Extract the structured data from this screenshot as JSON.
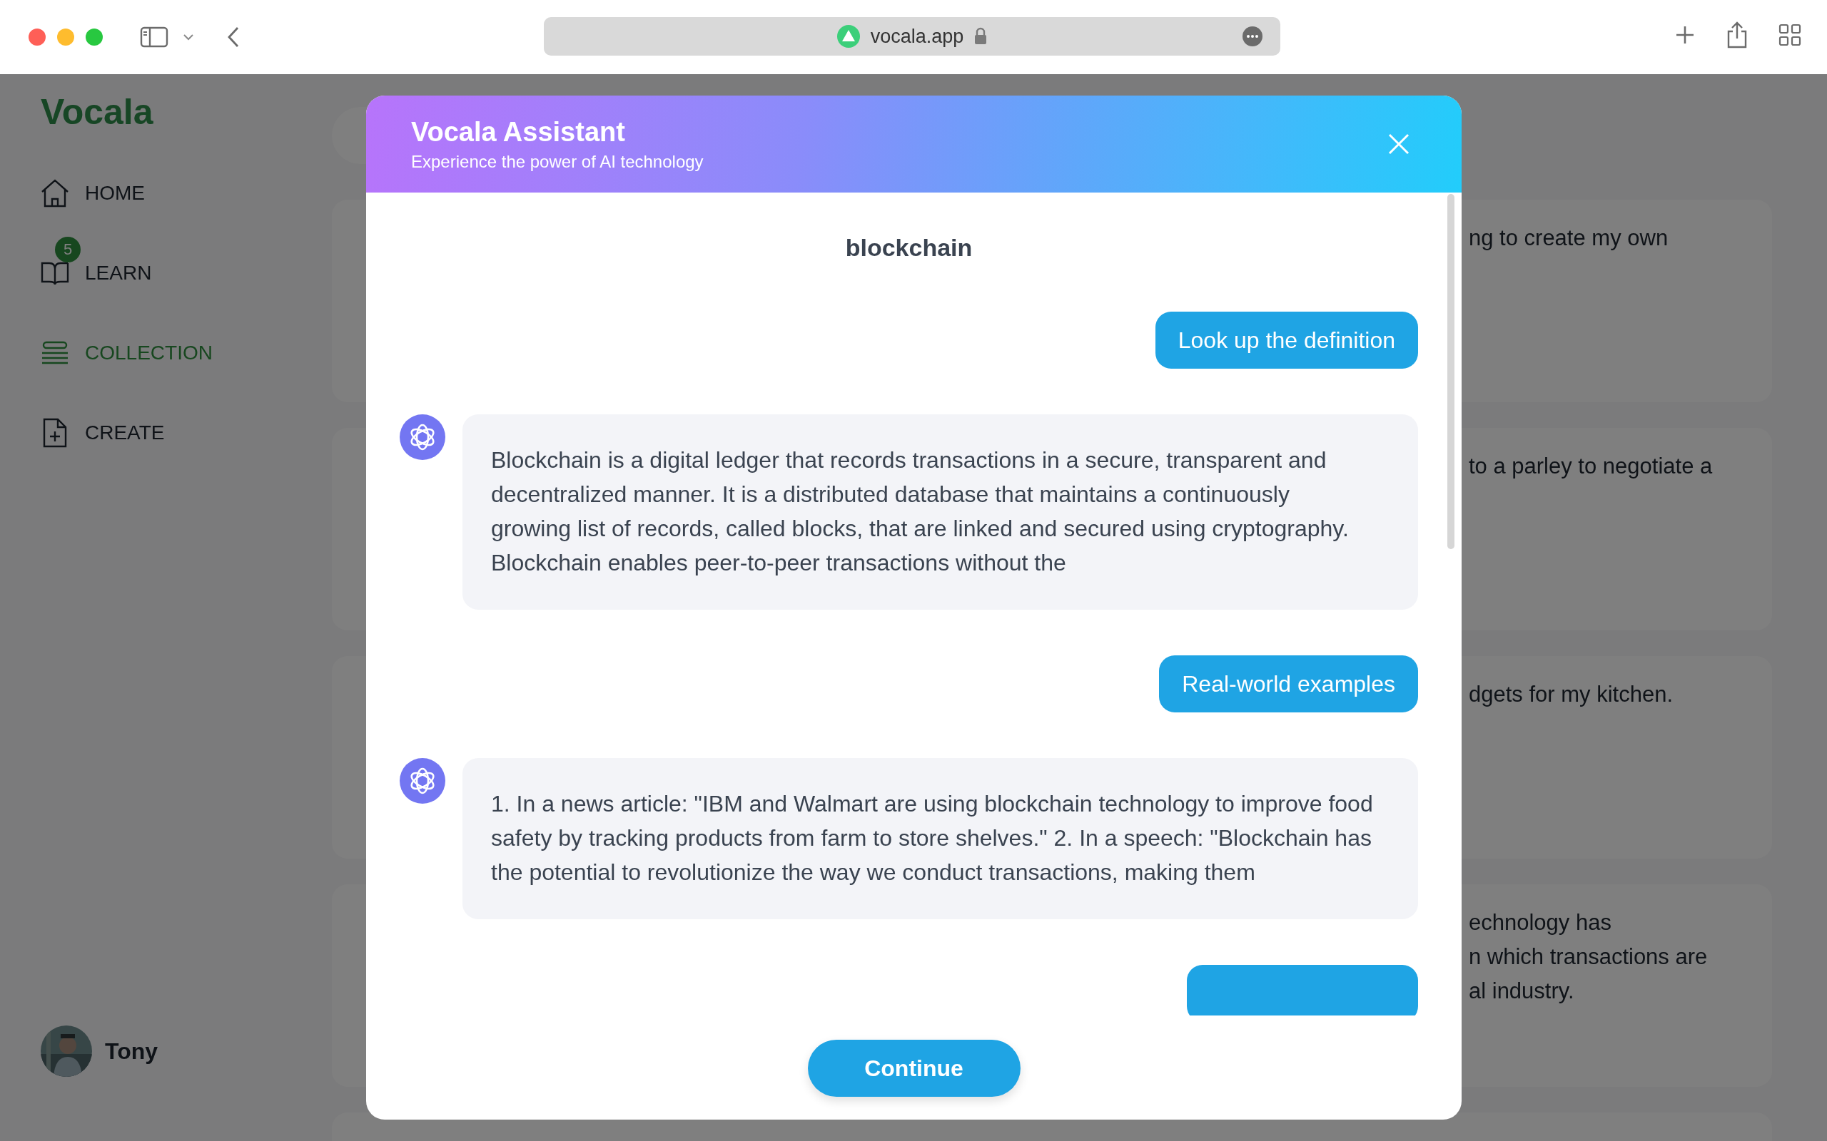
{
  "browser": {
    "url": "vocala.app"
  },
  "sidebar": {
    "logo": "Vocala",
    "items": [
      {
        "label": "HOME",
        "selected": false
      },
      {
        "label": "LEARN",
        "selected": false,
        "badge": "5"
      },
      {
        "label": "COLLECTION",
        "selected": true
      },
      {
        "label": "CREATE",
        "selected": false
      }
    ],
    "user": {
      "name": "Tony"
    }
  },
  "cards": [
    {
      "text": "ng to create my own"
    },
    {
      "text": "to a parley to negotiate a"
    },
    {
      "text": "dgets for my kitchen."
    },
    {
      "text": "echnology has\nn which transactions are\nal industry."
    }
  ],
  "modal": {
    "title": "Vocala Assistant",
    "subtitle": "Experience the power of AI technology",
    "word": "blockchain",
    "messages": [
      {
        "kind": "user",
        "text": "Look up the definition"
      },
      {
        "kind": "assistant",
        "text": "Blockchain is a digital ledger that records transactions in a secure, transparent and decentralized manner. It is a distributed database that maintains a continuously growing list of records, called blocks, that are linked and secured using cryptography. Blockchain enables peer-to-peer transactions without the"
      },
      {
        "kind": "user",
        "text": "Real-world examples"
      },
      {
        "kind": "assistant",
        "text": "1. In a news article: \"IBM and Walmart are using blockchain technology to improve food safety by tracking products from farm to store shelves.\" 2. In a speech: \"Blockchain has the potential to revolutionize the way we conduct transactions, making them"
      },
      {
        "kind": "user"
      }
    ],
    "button": "Continue"
  }
}
